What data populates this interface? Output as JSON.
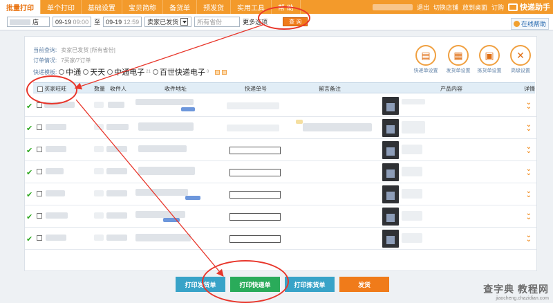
{
  "topnav": {
    "tabs": [
      "批量打印",
      "单个打印",
      "基础设置",
      "宝贝简称",
      "备货单",
      "预发货",
      "实用工具",
      "帮 助"
    ],
    "right_items": [
      "退出",
      "切换店铺",
      "放到桌面",
      "订购"
    ],
    "helper": "快递助手"
  },
  "filters": {
    "shop_suffix": "店",
    "date_from": "09-19",
    "time_from": "09:00",
    "separator": "至",
    "date_to": "09-19",
    "time_to": "12:59",
    "status": "卖家已发货",
    "province": "所有省份",
    "more": "更多选项",
    "query_button": "查 询",
    "online_help": "在线帮助"
  },
  "info": {
    "current_query_label": "当前查询:",
    "current_query_value": "卖家已发货 [所有省份]",
    "order_label": "订单情况:",
    "order_value": "7买家/7订单",
    "express_label": "快递模板:",
    "express_options": [
      {
        "label": "中通",
        "sup": ""
      },
      {
        "label": "天天",
        "sup": ""
      },
      {
        "label": "中通电子",
        "sup": "21"
      },
      {
        "label": "百世快递电子",
        "sup": "0"
      }
    ]
  },
  "quick_actions": [
    "快递单设置",
    "发货单设置",
    "拣货单设置",
    "高级设置"
  ],
  "table": {
    "headers": {
      "buyer": "买家旺旺",
      "qty": "数量",
      "receiver": "收件人",
      "address": "收件地址",
      "tracking": "快递单号",
      "note": "留言备注",
      "product": "产品内容",
      "detail": "详情"
    },
    "row_count": 7
  },
  "buttons": {
    "print_invoice": "打印发货单",
    "print_express": "打印快递单",
    "print_pick": "打印拣货单",
    "ship": "发货"
  },
  "colors": {
    "nav": "#f39a2b",
    "ship": "#f07b1a",
    "teal": "#38a3c8",
    "green": "#2aab5a",
    "annotation": "#e8362b"
  },
  "watermark": {
    "main": "查字典 教程网",
    "sub": "jiaocheng.chazidian.com"
  }
}
